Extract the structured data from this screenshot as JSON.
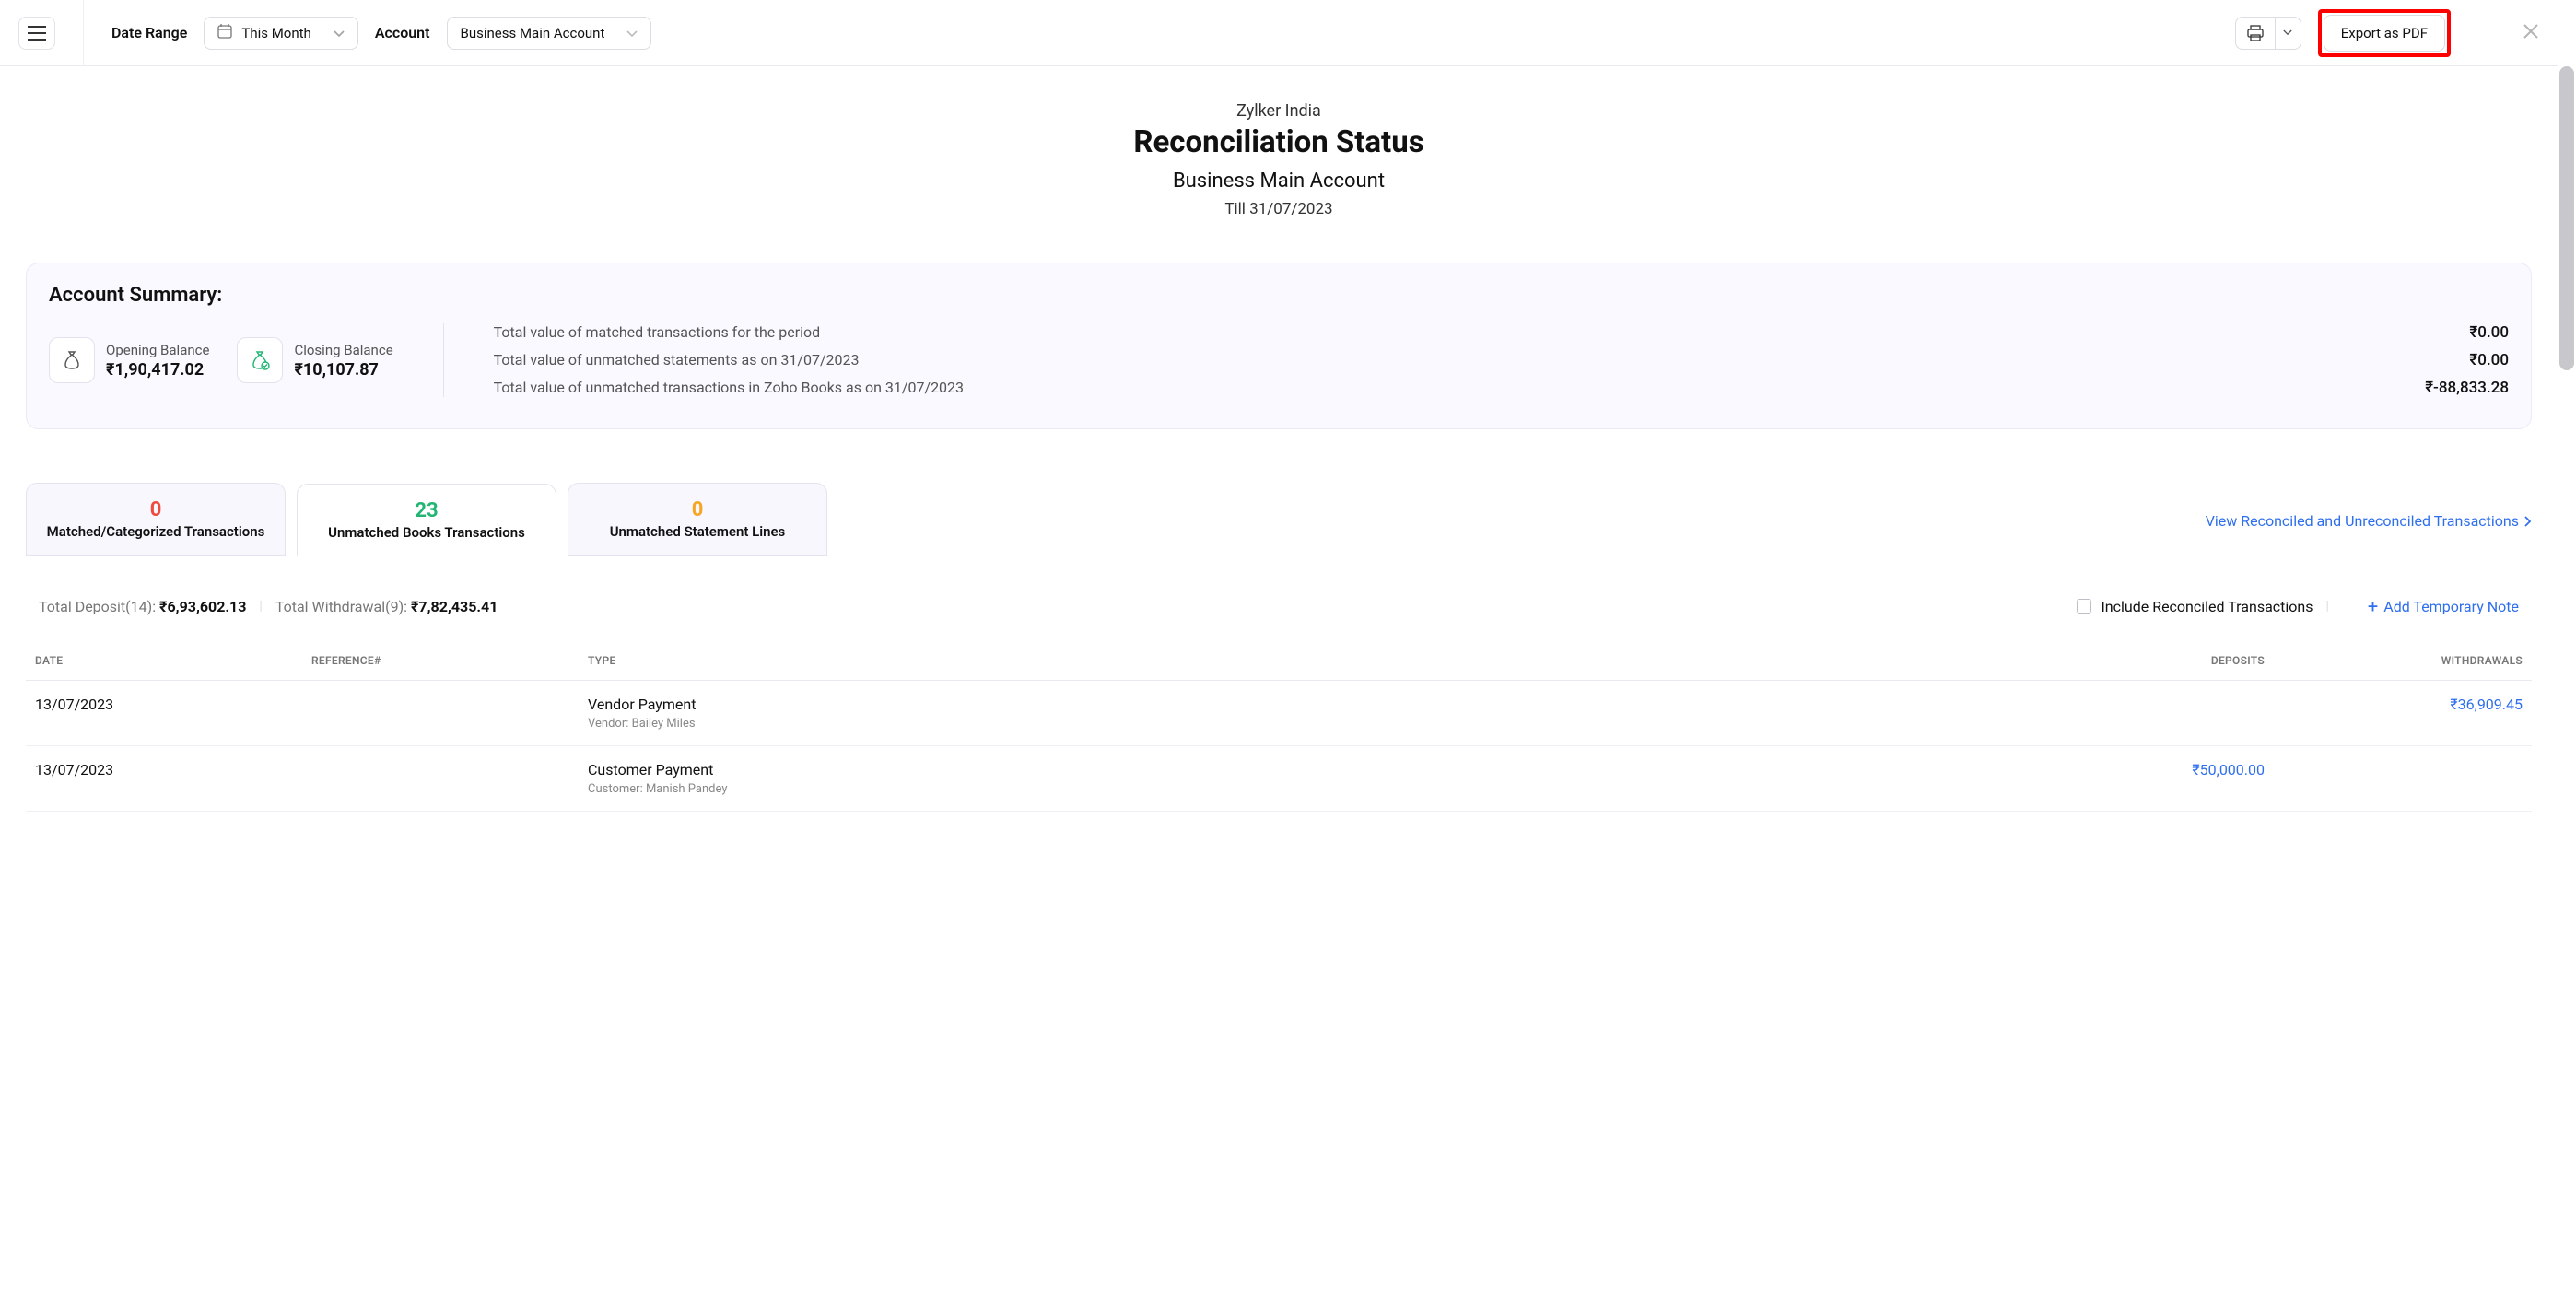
{
  "toolbar": {
    "date_range_label": "Date Range",
    "date_range_value": "This Month",
    "account_label": "Account",
    "account_value": "Business Main Account",
    "export_label": "Export as PDF"
  },
  "report": {
    "org": "Zylker India",
    "title": "Reconciliation Status",
    "account": "Business Main Account",
    "till": "Till 31/07/2023"
  },
  "summary": {
    "heading": "Account Summary:",
    "opening_label": "Opening Balance",
    "opening_value": "₹1,90,417.02",
    "closing_label": "Closing Balance",
    "closing_value": "₹10,107.87",
    "rows": [
      {
        "label": "Total value of matched transactions for the period",
        "amount": "₹0.00"
      },
      {
        "label": "Total value of unmatched statements as on 31/07/2023",
        "amount": "₹0.00"
      },
      {
        "label": "Total value of unmatched transactions in Zoho Books as on 31/07/2023",
        "amount": "₹-88,833.28"
      }
    ]
  },
  "tabs": [
    {
      "count": "0",
      "label": "Matched/Categorized Transactions",
      "color": "red"
    },
    {
      "count": "23",
      "label": "Unmatched Books Transactions",
      "color": "green"
    },
    {
      "count": "0",
      "label": "Unmatched Statement Lines",
      "color": "orange"
    }
  ],
  "view_link": "View Reconciled and Unreconciled Transactions",
  "totals_line": {
    "deposit_label": "Total Deposit",
    "deposit_count": "(14): ",
    "deposit_amount": "₹6,93,602.13",
    "withdrawal_label": "Total Withdrawal",
    "withdrawal_count": "(9): ",
    "withdrawal_amount": "₹7,82,435.41",
    "include_label": "Include Reconciled Transactions",
    "add_note": "Add Temporary Note"
  },
  "table": {
    "headers": {
      "date": "DATE",
      "ref": "REFERENCE#",
      "type": "TYPE",
      "deposits": "DEPOSITS",
      "withdrawals": "WITHDRAWALS"
    },
    "rows": [
      {
        "date": "13/07/2023",
        "ref": "",
        "type": "Vendor Payment",
        "sub": "Vendor: Bailey Miles",
        "deposit": "",
        "withdrawal": "₹36,909.45"
      },
      {
        "date": "13/07/2023",
        "ref": "",
        "type": "Customer Payment",
        "sub": "Customer: Manish Pandey",
        "deposit": "₹50,000.00",
        "withdrawal": ""
      }
    ]
  }
}
